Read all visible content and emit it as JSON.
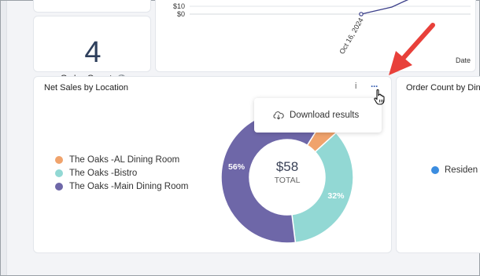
{
  "top_chart": {
    "y_tick_1": "$10",
    "y_tick_0": "$0",
    "x_date_label": "Oct 16, 2024",
    "x_axis_title": "Date"
  },
  "order_count": {
    "value": "4",
    "label": "Order Count",
    "info_icon": "info-icon"
  },
  "net_sales": {
    "title": "Net Sales by Location",
    "info_glyph": "i",
    "more_glyph": "···",
    "legend": [
      {
        "label": "The Oaks -AL Dining Room",
        "color": "#f0a36c"
      },
      {
        "label": "The Oaks -Bistro",
        "color": "#92d8d4"
      },
      {
        "label": "The Oaks -Main Dining Room",
        "color": "#6e67a8"
      }
    ],
    "donut": {
      "center_value": "$58",
      "center_label": "TOTAL",
      "slices": [
        {
          "name": "The Oaks -AL Dining Room",
          "percent": 4,
          "color": "#f0a36c",
          "label": ""
        },
        {
          "name": "The Oaks -Bistro",
          "percent": 32,
          "color": "#92d8d4",
          "label": "32%"
        },
        {
          "name": "The Oaks -Main Dining Room",
          "percent": 56,
          "color": "#6e67a8",
          "label": "56%"
        }
      ]
    }
  },
  "menu": {
    "download_label": "Download results",
    "download_icon": "cloud-download-icon"
  },
  "order_count_dining": {
    "title": "Order Count by Din",
    "legend_item": "Residen",
    "legend_color": "#3b8de0"
  },
  "annotation": {
    "arrow_color": "#e8403a",
    "cursor_icon": "hand-pointer-icon"
  }
}
